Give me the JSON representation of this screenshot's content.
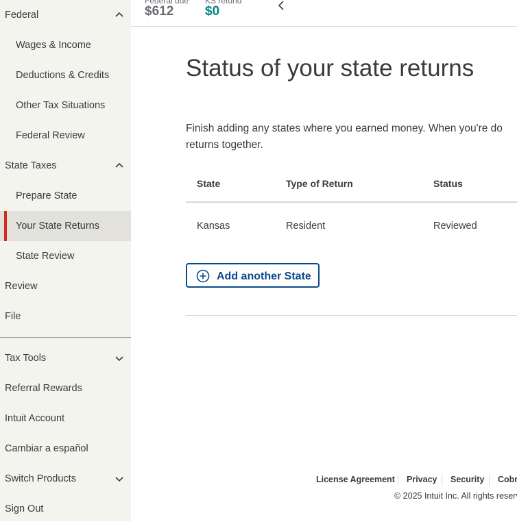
{
  "sidebar": {
    "items": [
      {
        "label": "Federal",
        "chevron": "up"
      },
      {
        "label": "Wages & Income"
      },
      {
        "label": "Deductions & Credits"
      },
      {
        "label": "Other Tax Situations"
      },
      {
        "label": "Federal Review"
      },
      {
        "label": "State Taxes",
        "chevron": "up"
      },
      {
        "label": "Prepare State"
      },
      {
        "label": "Your State Returns",
        "active": true
      },
      {
        "label": "State Review"
      },
      {
        "label": "Review"
      },
      {
        "label": "File"
      },
      {
        "label": "Tax Tools",
        "chevron": "down"
      },
      {
        "label": "Referral Rewards"
      },
      {
        "label": "Intuit Account"
      },
      {
        "label": "Cambiar a español"
      },
      {
        "label": "Switch Products",
        "chevron": "down"
      },
      {
        "label": "Sign Out"
      }
    ]
  },
  "header": {
    "federal_due_label": "Federal due",
    "federal_due_amount": "$612",
    "refund_label": "KS refund",
    "refund_amount": "$0"
  },
  "main": {
    "title": "Status of your state returns",
    "intro_line1": "Finish adding any states where you earned money. When you're do",
    "intro_line2": "returns together.",
    "table": {
      "headers": [
        "State",
        "Type of Return",
        "Status"
      ],
      "rows": [
        [
          "Kansas",
          "Resident",
          "Reviewed"
        ]
      ]
    },
    "add_button": "Add another State"
  },
  "footer": {
    "links": [
      "License Agreement",
      "Privacy",
      "Security",
      "Cobr"
    ],
    "copyright": "© 2025 Intuit Inc. All rights reserv"
  },
  "colors": {
    "accent_red": "#d52b1e",
    "link_blue": "#0d4a8c",
    "refund_green": "#008481",
    "sidebar_bg": "#f4f4ef"
  }
}
